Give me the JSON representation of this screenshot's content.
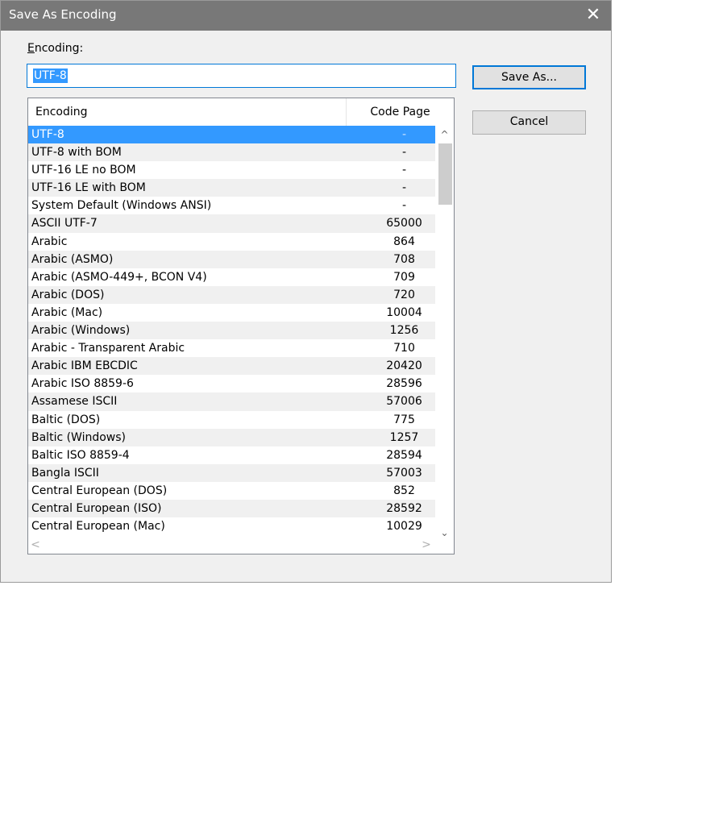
{
  "dialog": {
    "title": "Save As Encoding",
    "close_glyph": "✕",
    "encoding_label_prefix": "E",
    "encoding_label_rest": "ncoding:",
    "encoding_value": "UTF-8",
    "save_as_label": "Save As...",
    "cancel_label": "Cancel"
  },
  "list": {
    "columns": [
      "Encoding",
      "Code Page"
    ],
    "rows": [
      {
        "name": "UTF-8",
        "code": "-"
      },
      {
        "name": "UTF-8 with BOM",
        "code": "-"
      },
      {
        "name": "UTF-16 LE no BOM",
        "code": "-"
      },
      {
        "name": "UTF-16 LE with BOM",
        "code": "-"
      },
      {
        "name": "System Default (Windows ANSI)",
        "code": "-"
      },
      {
        "name": "ASCII UTF-7",
        "code": "65000"
      },
      {
        "name": "Arabic",
        "code": "864"
      },
      {
        "name": "Arabic (ASMO)",
        "code": "708"
      },
      {
        "name": "Arabic (ASMO-449+, BCON V4)",
        "code": "709"
      },
      {
        "name": "Arabic (DOS)",
        "code": "720"
      },
      {
        "name": "Arabic (Mac)",
        "code": "10004"
      },
      {
        "name": "Arabic (Windows)",
        "code": "1256"
      },
      {
        "name": "Arabic - Transparent Arabic",
        "code": "710"
      },
      {
        "name": "Arabic IBM EBCDIC",
        "code": "20420"
      },
      {
        "name": "Arabic ISO 8859-6",
        "code": "28596"
      },
      {
        "name": "Assamese ISCII",
        "code": "57006"
      },
      {
        "name": "Baltic (DOS)",
        "code": "775"
      },
      {
        "name": "Baltic (Windows)",
        "code": "1257"
      },
      {
        "name": "Baltic ISO 8859-4",
        "code": "28594"
      },
      {
        "name": "Bangla ISCII",
        "code": "57003"
      },
      {
        "name": "Central European (DOS)",
        "code": "852"
      },
      {
        "name": "Central European (ISO)",
        "code": "28592"
      },
      {
        "name": "Central European (Mac)",
        "code": "10029"
      }
    ],
    "selected_index": 0
  },
  "scrollbars": {
    "up_glyph": "^",
    "down_glyph": "⌄",
    "left_glyph": "<",
    "right_glyph": ">"
  },
  "colors": {
    "titlebar": "#787878",
    "selection": "#3399ff",
    "focus_border": "#0078d7"
  }
}
